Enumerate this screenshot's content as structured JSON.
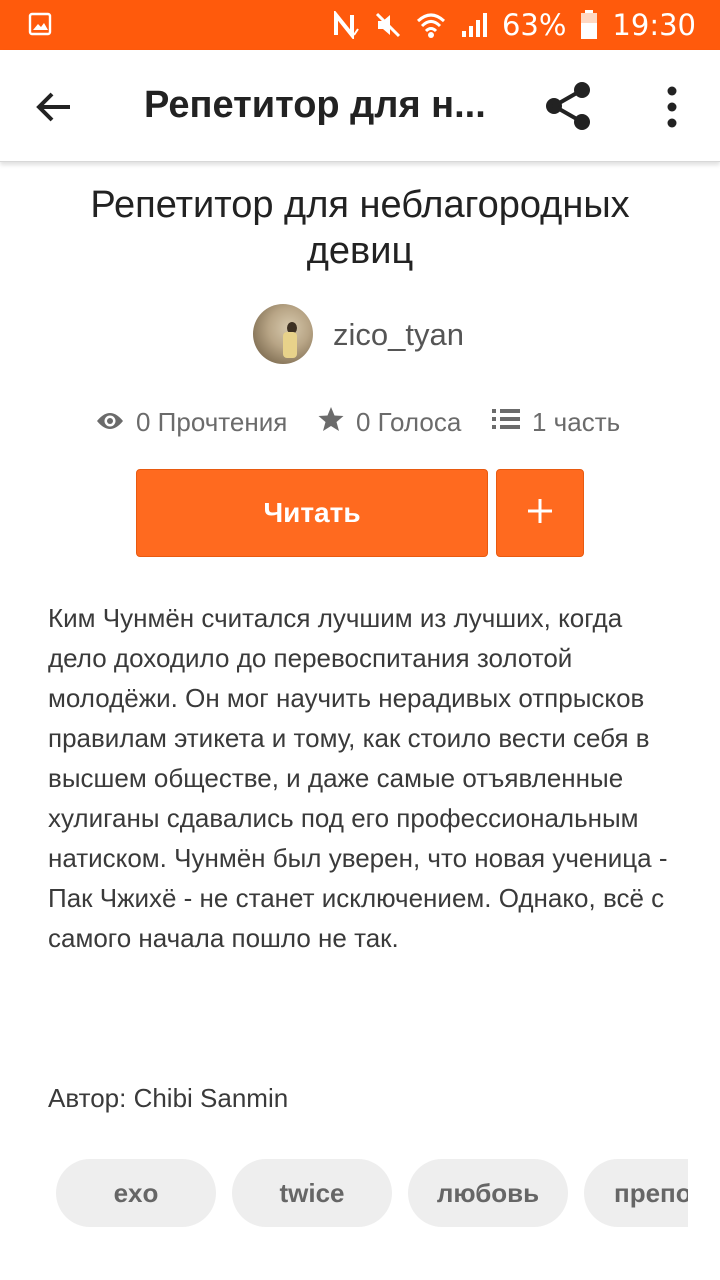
{
  "status_bar": {
    "battery": "63%",
    "time": "19:30",
    "icons": [
      "image-icon",
      "nfc-icon",
      "mute-icon",
      "wifi-icon",
      "signal-icon",
      "battery-icon"
    ]
  },
  "toolbar": {
    "title": "Репетитор для н...",
    "back_icon": "arrow-left-icon",
    "share_icon": "share-icon",
    "more_icon": "more-vertical-icon"
  },
  "story": {
    "title": "Репетитор для неблагородных девиц",
    "author": "zico_tyan",
    "stats": {
      "reads": "0 Прочтения",
      "votes": "0 Голоса",
      "parts": "1 часть"
    },
    "read_button": "Читать",
    "add_button": "+",
    "description": "Ким Чунмён считался лучшим из лучших, когда дело доходило до перевоспитания золотой молодёжи. Он мог научить нерадивых отпрысков правилам этикета и тому, как стоило вести себя в высшем обществе, и даже самые отъявленные хулиганы сдавались под его профессиональным натиском. Чунмён был уверен, что новая ученица - Пак Чжихё - не станет исключением. Однако, всё с самого начала пошло не так.",
    "author_line": "Автор: Chibi Sanmin",
    "tags": [
      "exo",
      "twice",
      "любовь",
      "препо"
    ]
  },
  "colors": {
    "accent": "#ff5a0c",
    "button": "#ff6a1f",
    "tag_bg": "#eeeeee"
  }
}
